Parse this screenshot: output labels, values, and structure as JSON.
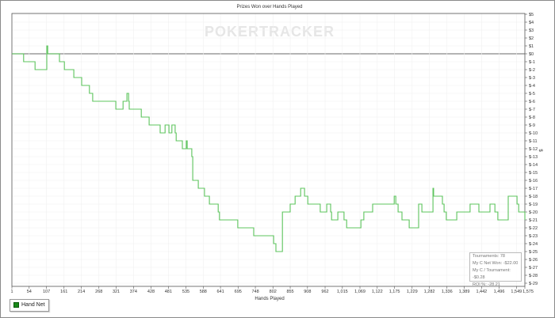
{
  "chart_data": {
    "type": "line",
    "title": "Prizes Won over Hands Played",
    "xlabel": "Hands Played",
    "ylabel": "$",
    "watermark": "POKERTRACKER",
    "xlim": [
      1,
      1575
    ],
    "ylim": [
      -29,
      5
    ],
    "grid": true,
    "legend_placement": "bottom-left",
    "x_ticks": [
      "1",
      "54",
      "107",
      "161",
      "214",
      "268",
      "321",
      "374",
      "428",
      "481",
      "535",
      "588",
      "641",
      "695",
      "748",
      "802",
      "855",
      "908",
      "962",
      "1,015",
      "1,069",
      "1,122",
      "1,175",
      "1,229",
      "1,282",
      "1,336",
      "1,389",
      "1,442",
      "1,496",
      "1,549",
      "1,575"
    ],
    "x_tick_values": [
      1,
      54,
      107,
      161,
      214,
      268,
      321,
      374,
      428,
      481,
      535,
      588,
      641,
      695,
      748,
      802,
      855,
      908,
      962,
      1015,
      1069,
      1122,
      1175,
      1229,
      1282,
      1336,
      1389,
      1442,
      1496,
      1549,
      1575
    ],
    "y_ticks": [
      "$5",
      "$4",
      "$3",
      "$2",
      "$1",
      "$0",
      "$-1",
      "$-2",
      "$-3",
      "$-4",
      "$-5",
      "$-6",
      "$-7",
      "$-8",
      "$-9",
      "$-10",
      "$-11",
      "$-12",
      "$-13",
      "$-14",
      "$-15",
      "$-16",
      "$-17",
      "$-18",
      "$-19",
      "$-20",
      "$-21",
      "$-22",
      "$-23",
      "$-24",
      "$-25",
      "$-26",
      "$-27",
      "$-28",
      "$-29"
    ],
    "series": [
      {
        "name": "Hand Net",
        "color": "#5cc45c",
        "step_points": [
          [
            1,
            0
          ],
          [
            37,
            -1
          ],
          [
            72,
            -2
          ],
          [
            108,
            1
          ],
          [
            111,
            0
          ],
          [
            147,
            -1
          ],
          [
            162,
            -2
          ],
          [
            191,
            -3
          ],
          [
            215,
            -4
          ],
          [
            239,
            -5
          ],
          [
            249,
            -6
          ],
          [
            320,
            -7
          ],
          [
            342,
            -6
          ],
          [
            354,
            -5
          ],
          [
            359,
            -6
          ],
          [
            361,
            -7
          ],
          [
            398,
            -8
          ],
          [
            422,
            -9
          ],
          [
            456,
            -10
          ],
          [
            471,
            -9
          ],
          [
            483,
            -10
          ],
          [
            492,
            -9
          ],
          [
            502,
            -10
          ],
          [
            505,
            -11
          ],
          [
            524,
            -12
          ],
          [
            536,
            -11
          ],
          [
            539,
            -12
          ],
          [
            553,
            -13
          ],
          [
            556,
            -16
          ],
          [
            573,
            -17
          ],
          [
            592,
            -18
          ],
          [
            607,
            -19
          ],
          [
            634,
            -20
          ],
          [
            638,
            -21
          ],
          [
            694,
            -22
          ],
          [
            743,
            -23
          ],
          [
            792,
            -23
          ],
          [
            804,
            -24
          ],
          [
            811,
            -25
          ],
          [
            831,
            -20
          ],
          [
            855,
            -19
          ],
          [
            870,
            -18
          ],
          [
            887,
            -17
          ],
          [
            899,
            -18
          ],
          [
            909,
            -19
          ],
          [
            947,
            -20
          ],
          [
            967,
            -19
          ],
          [
            979,
            -20
          ],
          [
            982,
            -21
          ],
          [
            1001,
            -20
          ],
          [
            1020,
            -21
          ],
          [
            1028,
            -22
          ],
          [
            1072,
            -21
          ],
          [
            1081,
            -20
          ],
          [
            1108,
            -19
          ],
          [
            1174,
            -18
          ],
          [
            1179,
            -19
          ],
          [
            1186,
            -20
          ],
          [
            1198,
            -21
          ],
          [
            1220,
            -22
          ],
          [
            1249,
            -19
          ],
          [
            1259,
            -20
          ],
          [
            1293,
            -17
          ],
          [
            1295,
            -18
          ],
          [
            1322,
            -19
          ],
          [
            1327,
            -20
          ],
          [
            1334,
            -21
          ],
          [
            1366,
            -20
          ],
          [
            1407,
            -19
          ],
          [
            1434,
            -20
          ],
          [
            1468,
            -19
          ],
          [
            1483,
            -20
          ],
          [
            1492,
            -21
          ],
          [
            1524,
            -18
          ],
          [
            1551,
            -19
          ],
          [
            1556,
            -20
          ],
          [
            1575,
            -21
          ]
        ]
      }
    ],
    "summary": {
      "tournaments": "Tournaments: 78",
      "net_won": "My C Net Won: -$22.00",
      "per_tournament": "My C / Tournament: -$0.28",
      "roi": "ROI %: -28.21"
    }
  }
}
